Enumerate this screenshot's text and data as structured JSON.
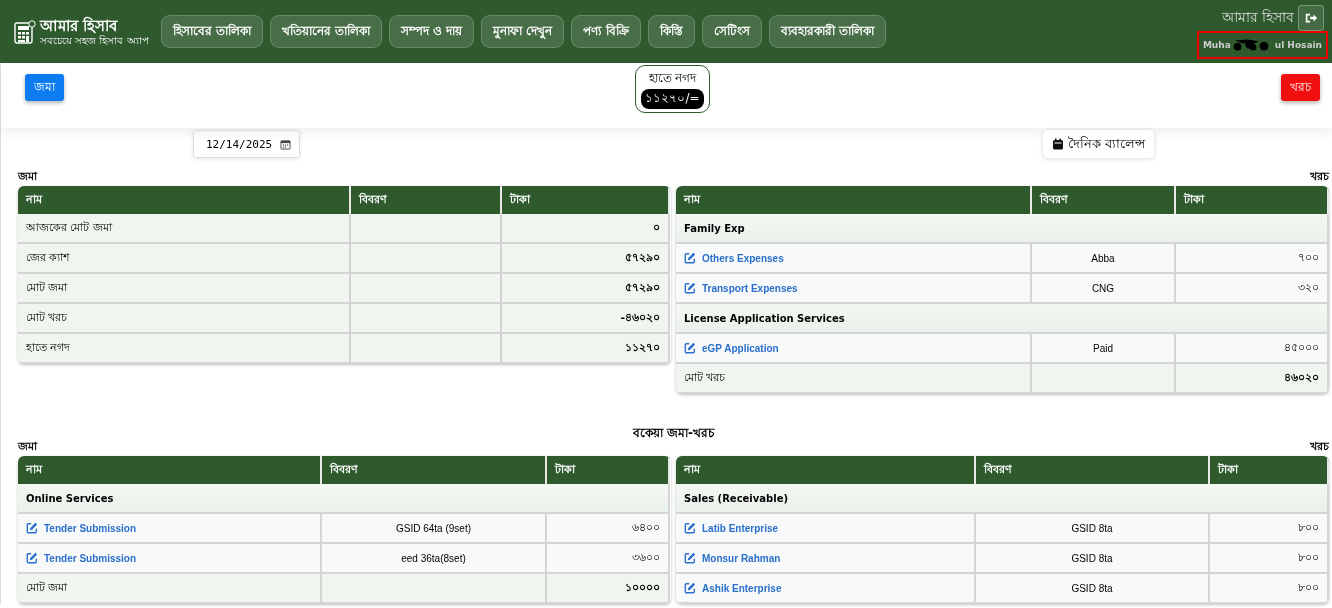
{
  "header": {
    "app_title": "আমার হিসাব",
    "app_subtitle": "সবচেয়ে সহজ হিসাব অ্যাপ",
    "nav": [
      {
        "label": "হিসাবের তালিকা"
      },
      {
        "label": "খতিয়ানের তালিকা"
      },
      {
        "label": "সম্পদ ও দায়"
      },
      {
        "label": "মুনাফা দেখুন"
      },
      {
        "label": "পণ্য বিক্রি"
      },
      {
        "label": "কিস্তি"
      },
      {
        "label": "সেটিংস"
      },
      {
        "label": "ব্যবহারকারী তালিকা"
      }
    ],
    "account_label": "আমার হিসাব",
    "user_name_start": "Muha",
    "user_name_end": "ul Hosain"
  },
  "top_bar": {
    "deposit_button": "জমা",
    "cash": {
      "label": "হাতে নগদ",
      "amount": "১১২৭০/="
    },
    "expense_button": "খরচ"
  },
  "date_field": {
    "value": "12/14/2025"
  },
  "daily_balance_button": "দৈনিক ব্যালেন্স",
  "sections": [
    {
      "left": {
        "label": "জমা",
        "columns": [
          "নাম",
          "বিবরণ",
          "টাকা"
        ],
        "rows": [
          {
            "kind": "summary",
            "name": "আজকের মোট জমা",
            "amount": "০"
          },
          {
            "kind": "summary",
            "name": "জের ক্যাশ",
            "amount": "৫৭২৯০"
          },
          {
            "kind": "summary",
            "name": "মোট জমা",
            "amount": "৫৭২৯০"
          },
          {
            "kind": "summary",
            "name": "মোট খরচ",
            "amount": "-৪৬০২০"
          },
          {
            "kind": "summary",
            "name": "হাতে নগদ",
            "amount": "১১২৭০"
          }
        ]
      },
      "right": {
        "label": "খরচ",
        "columns": [
          "নাম",
          "বিবরণ",
          "টাকা"
        ],
        "rows": [
          {
            "kind": "group",
            "name": "Family Exp"
          },
          {
            "kind": "item",
            "name": "Others Expenses",
            "description": "Abba",
            "amount": "৭০০"
          },
          {
            "kind": "item",
            "name": "Transport Expenses",
            "description": "CNG",
            "amount": "৩২০"
          },
          {
            "kind": "group",
            "name": "License Application Services"
          },
          {
            "kind": "item",
            "name": "eGP Application",
            "description": "Paid",
            "amount": "৪৫০০০"
          },
          {
            "kind": "summary",
            "name": "মোট খরচ",
            "amount": "৪৬০২০"
          }
        ]
      }
    },
    {
      "title": "বকেয়া জমা-খরচ",
      "left": {
        "label": "জমা",
        "columns": [
          "নাম",
          "বিবরণ",
          "টাকা"
        ],
        "rows": [
          {
            "kind": "group",
            "name": "Online Services"
          },
          {
            "kind": "item",
            "name": "Tender Submission",
            "description": "GSID 64ta (9set)",
            "amount": "৬৪০০"
          },
          {
            "kind": "item",
            "name": "Tender Submission",
            "description": "eed 36ta(8set)",
            "amount": "৩৬০০"
          },
          {
            "kind": "summary",
            "name": "মোট জমা",
            "amount": "১০০০০"
          }
        ]
      },
      "right": {
        "label": "খরচ",
        "columns": [
          "নাম",
          "বিবরণ",
          "টাকা"
        ],
        "rows": [
          {
            "kind": "group",
            "name": "Sales (Receivable)"
          },
          {
            "kind": "item",
            "name": "Latib Enterprise",
            "description": "GSID 8ta",
            "amount": "৮০০"
          },
          {
            "kind": "item",
            "name": "Monsur Rahman",
            "description": "GSID 8ta",
            "amount": "৮০০"
          },
          {
            "kind": "item",
            "name": "Ashik Enterprise",
            "description": "GSID 8ta",
            "amount": "৮০০"
          }
        ]
      }
    }
  ]
}
